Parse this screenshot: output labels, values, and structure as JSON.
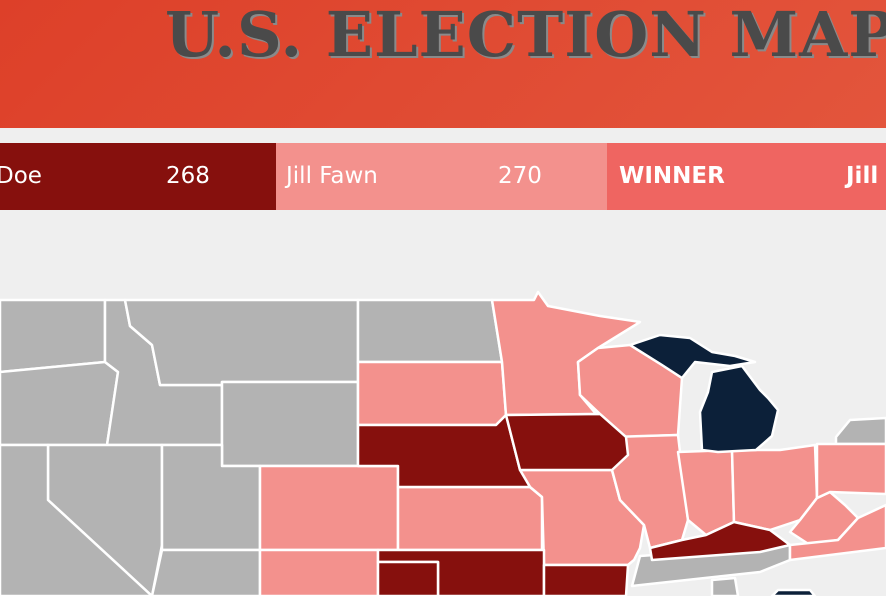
{
  "header": {
    "title": "U.S. ELECTION MAP"
  },
  "scoreboard": {
    "candidate_a": {
      "name": "Doe",
      "votes": "268"
    },
    "candidate_b": {
      "name": "Jill Fawn",
      "votes": "270"
    },
    "winner": {
      "label": "WINNER",
      "name": "Jill"
    }
  },
  "colors": {
    "header": "#dd4029",
    "candidate_a": "#86100d",
    "candidate_b": "#f3918d",
    "winner_bar": "#ef6561",
    "state_uncalled": "#b3b3b3",
    "state_light": "#f3918d",
    "state_dark": "#86100d",
    "state_navy": "#0c2039"
  }
}
